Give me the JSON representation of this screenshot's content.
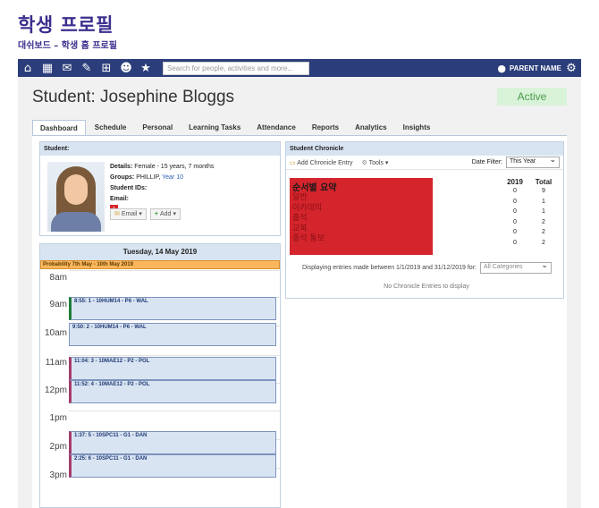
{
  "header": {
    "title": "학생 프로필",
    "subtitle": "대쉬보드 – 학생 홈 프로필"
  },
  "navbar": {
    "search_placeholder": "Search for people, activities and more...",
    "user_name": "PARENT NAME",
    "icons": [
      "home-icon",
      "calendar-icon",
      "mail-icon",
      "pencil-icon",
      "grid-icon",
      "people-icon",
      "star-icon"
    ]
  },
  "student": {
    "name": "Student: Josephine Bloggs",
    "status": "Active"
  },
  "tabs": [
    "Dashboard",
    "Schedule",
    "Personal",
    "Learning Tasks",
    "Attendance",
    "Reports",
    "Analytics",
    "Insights"
  ],
  "student_panel": {
    "title": "Student:",
    "details_label": "Details:",
    "details_value": "Female - 15 years, 7 months",
    "groups_label": "Groups:",
    "groups_value": "PHILLIP,",
    "groups_link": "Year 10",
    "ids_label": "Student IDs:",
    "email_label": "Email:",
    "email_button": "Email",
    "add_button": "Add"
  },
  "calendar": {
    "date": "Tuesday, 14 May 2019",
    "banner": "Probability 7th May - 10th May 2019",
    "hours": [
      "8am",
      "9am",
      "10am",
      "11am",
      "12pm",
      "1pm",
      "2pm",
      "3pm"
    ],
    "events": [
      "8:55: 1 - 10HUM14 - P6 - WAL",
      "9:50: 2 - 10HUM14 - P6 - WAL",
      "11:04: 3 - 10MAE12 - P2 - POL",
      "11:52: 4 - 10MAE12 - P2 - POL",
      "1:37: 5 - 10SPC11 - G1 - DAN",
      "2:25: 6 - 10SPC11 - G1 - DAN"
    ]
  },
  "chronicle": {
    "title": "Student Chronicle",
    "add_entry": "Add Chronicle Entry",
    "tools": "Tools",
    "date_filter_label": "Date Filter:",
    "date_filter_value": "This Year",
    "summary_title": "순서별 요약",
    "categories": [
      "일반",
      "아카데믹",
      "출석",
      "교복",
      "종석 통보"
    ],
    "col_year": "2019",
    "col_total": "Total",
    "year_counts": [
      "0",
      "0",
      "0",
      "0",
      "0",
      "0"
    ],
    "total_counts": [
      "9",
      "1",
      "1",
      "2",
      "2",
      "2"
    ],
    "displaying": "Displaying entries made between 1/1/2019 and 31/12/2019 for:",
    "category_select": "All Categories",
    "empty": "No Chronicle Entries to display"
  },
  "colors": {
    "nav": "#2b3d7a",
    "title": "#3a2f8e",
    "summary_box": "#d4242c",
    "event_fill": "#d9e4f3"
  }
}
